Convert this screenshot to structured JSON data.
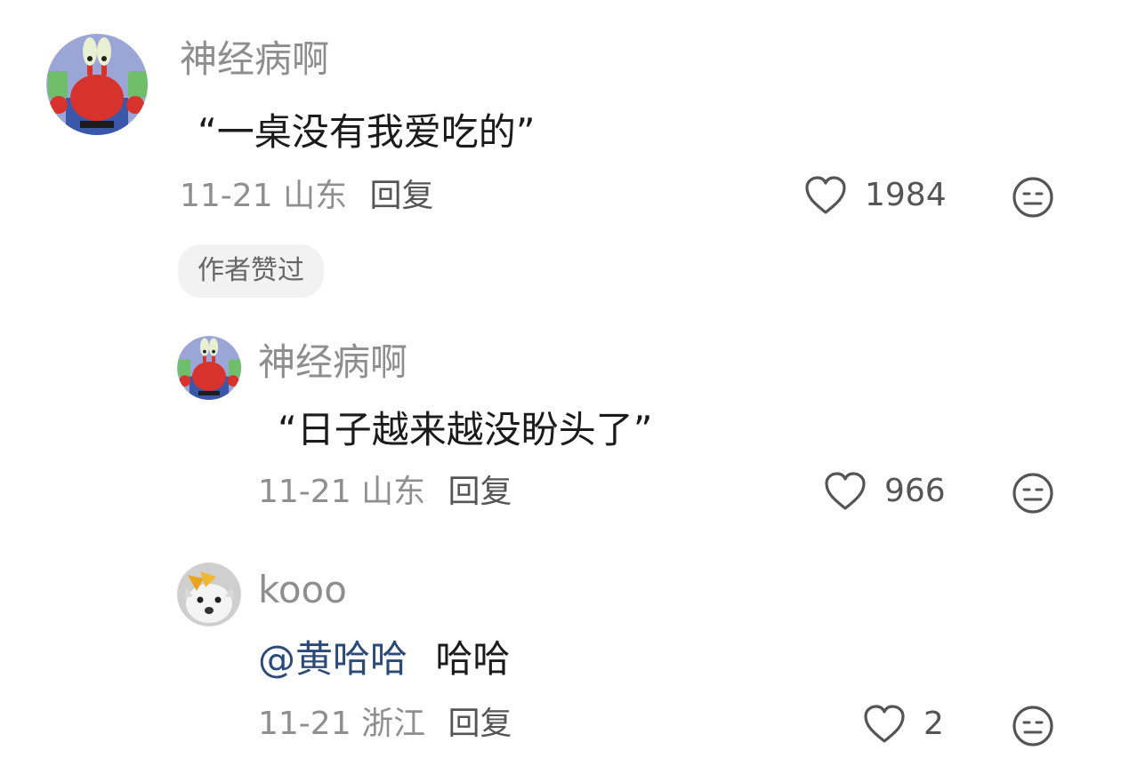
{
  "comments": [
    {
      "user": "神经病啊",
      "text": "“一桌没有我爱吃的”",
      "date": "11-21",
      "location": "山东",
      "reply_label": "回复",
      "likes": "1984",
      "badge": "作者赞过",
      "avatar_icon": "crab-avatar"
    },
    {
      "user": "神经病啊",
      "text": "“日子越来越没盼头了”",
      "date": "11-21",
      "location": "山东",
      "reply_label": "回复",
      "likes": "966",
      "avatar_icon": "crab-avatar"
    },
    {
      "user": "kooo",
      "mention": "@黄哈哈",
      "text": "哈哈",
      "date": "11-21",
      "location": "浙江",
      "reply_label": "回复",
      "likes": "2",
      "avatar_icon": "cat-avatar"
    }
  ],
  "colors": {
    "name": "#8e8e8e",
    "mention": "#2b4a78",
    "icon": "#555555"
  }
}
